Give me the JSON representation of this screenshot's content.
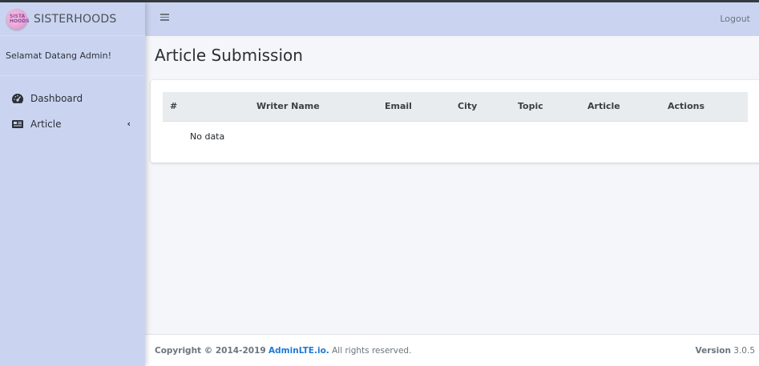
{
  "brand": {
    "name": "SISTERHOODS",
    "logo_text": "SISTA HOODS"
  },
  "user": {
    "greeting": "Selamat Datang Admin!"
  },
  "sidebar": {
    "items": [
      {
        "label": "Dashboard",
        "icon": "tachometer-icon"
      },
      {
        "label": "Article",
        "icon": "newspaper-icon"
      }
    ],
    "chevron": "‹"
  },
  "header": {
    "logout_label": "Logout"
  },
  "page": {
    "title": "Article Submission"
  },
  "table": {
    "columns": [
      "#",
      "Writer Name",
      "Email",
      "City",
      "Topic",
      "Article",
      "Actions"
    ],
    "empty_text": "No data"
  },
  "footer": {
    "copyright_prefix": "Copyright © 2014-2019",
    "link": "AdminLTE.io.",
    "suffix": "All rights reserved.",
    "version_label": "Version",
    "version_value": "3.0.5"
  },
  "colors": {
    "sidebar": "#cad4f0",
    "link": "#1e7ad4",
    "background": "#f4f6f9"
  }
}
